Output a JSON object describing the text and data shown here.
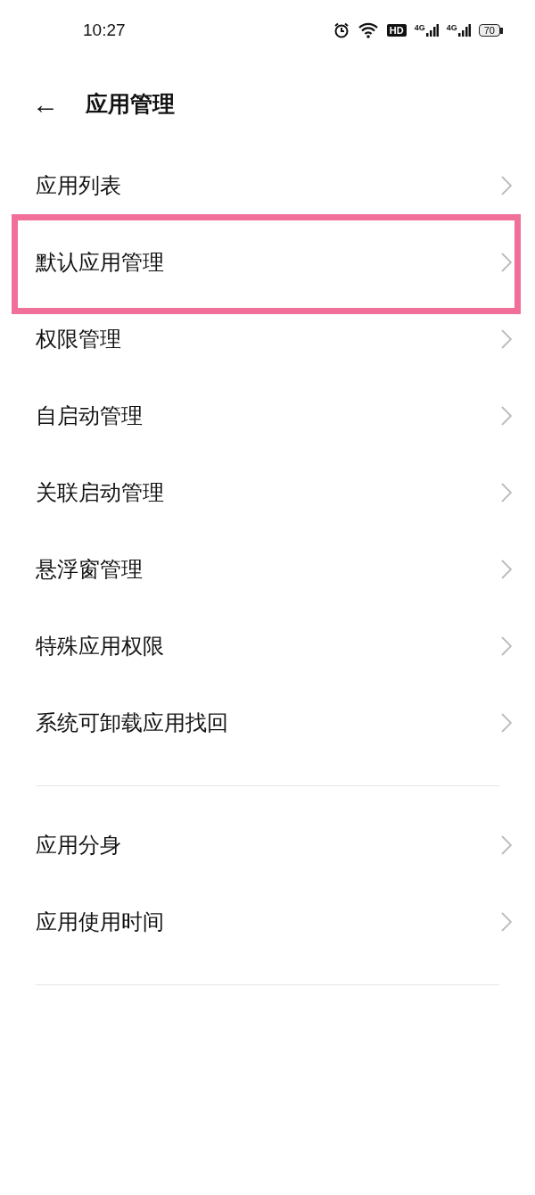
{
  "status_bar": {
    "time": "10:27",
    "hd": "HD",
    "signal_1": "4G",
    "signal_2": "4G",
    "battery": "70"
  },
  "header": {
    "back": "←",
    "title": "应用管理"
  },
  "groups": [
    {
      "items": [
        {
          "label": "应用列表",
          "highlighted": false
        },
        {
          "label": "默认应用管理",
          "highlighted": true
        },
        {
          "label": "权限管理",
          "highlighted": false
        },
        {
          "label": "自启动管理",
          "highlighted": false
        },
        {
          "label": "关联启动管理",
          "highlighted": false
        },
        {
          "label": "悬浮窗管理",
          "highlighted": false
        },
        {
          "label": "特殊应用权限",
          "highlighted": false
        },
        {
          "label": "系统可卸载应用找回",
          "highlighted": false
        }
      ]
    },
    {
      "items": [
        {
          "label": "应用分身",
          "highlighted": false
        },
        {
          "label": "应用使用时间",
          "highlighted": false
        }
      ]
    }
  ]
}
